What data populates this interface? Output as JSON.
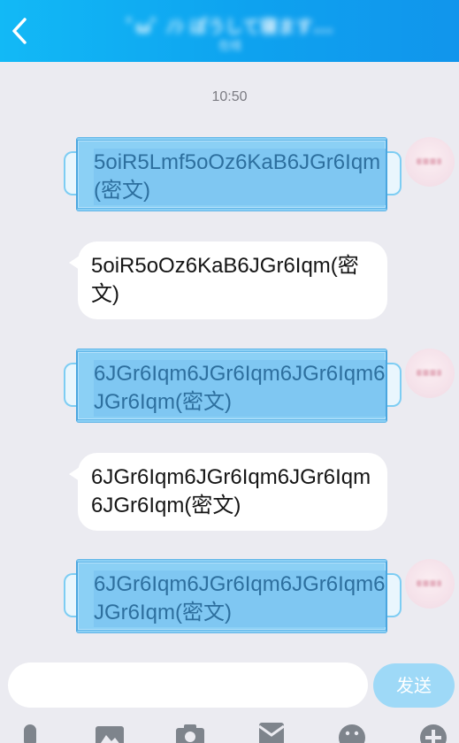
{
  "header": {
    "title": "ﾟωﾟ ﾉｼ ぽうして寝ます...",
    "status": "在线"
  },
  "time_label": "10:50",
  "messages": [
    {
      "from": "me",
      "text": "5oiR5Lmf5oOz6KaB6JGr6Iqm(密文)"
    },
    {
      "from": "them",
      "text": "5oiR5oOz6KaB6JGr6Iqm(密文)"
    },
    {
      "from": "me",
      "text": "6JGr6Iqm6JGr6Iqm6JGr6Iqm6JGr6Iqm(密文)"
    },
    {
      "from": "them",
      "text": "6JGr6Iqm6JGr6Iqm6JGr6Iqm6JGr6Iqm(密文)"
    },
    {
      "from": "me",
      "text": "6JGr6Iqm6JGr6Iqm6JGr6Iqm6JGr6Iqm(密文)"
    }
  ],
  "input": {
    "value": "",
    "placeholder": ""
  },
  "send_label": "发送",
  "toolbar_icons": [
    "microphone-icon",
    "image-icon",
    "camera-icon",
    "red-packet-icon",
    "emoji-icon",
    "plus-icon"
  ],
  "colors": {
    "header": "#0ea2ef",
    "sent_bubble": "#8bd0f5",
    "sent_text": "#2d6f9e",
    "send_button": "#9ed9f7",
    "background": "#ebebf1"
  }
}
